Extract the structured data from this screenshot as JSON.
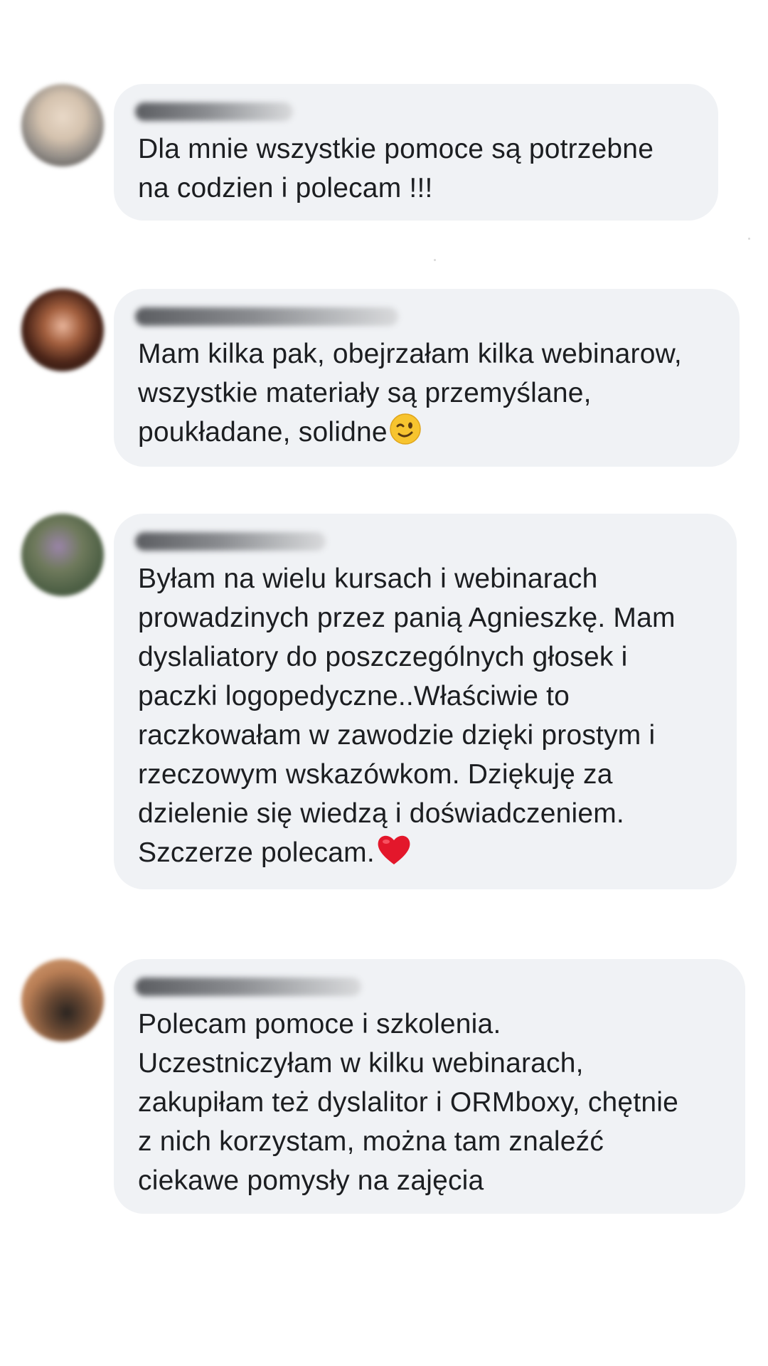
{
  "comments": [
    {
      "text": "Dla mnie wszystkie pomoce są potrzebne\nna codzien i polecam !!!",
      "emoji": ""
    },
    {
      "text": "Mam kilka pak, obejrzałam kilka webinarow,\nwszystkie materiały są przemyślane,\npoukładane, solidne",
      "emoji": "winking-face"
    },
    {
      "text": "Byłam na wielu kursach i webinarach\nprowadzinych przez panią Agnieszkę. Mam\ndyslaliatory do poszczególnych głosek i\npaczki logopedyczne..Właściwie to\nraczkowałam w zawodzie dzięki prostym i\nrzeczowym wskazówkom. Dziękuję za\ndzielenie się wiedzą i doświadczeniem.\nSzczerze polecam.",
      "emoji": "red-heart"
    },
    {
      "text": "Polecam pomoce i szkolenia.\nUczestniczyłam w kilku webinarach,\nzakupiłam też dyslalitor i ORMboxy, chętnie\nz nich korzystam, można tam znaleźć\nciekawe pomysły na zajęcia",
      "emoji": ""
    }
  ],
  "colors": {
    "bubble_background": "#f0f2f5",
    "text": "#1c1e21",
    "page_background": "#ffffff"
  }
}
